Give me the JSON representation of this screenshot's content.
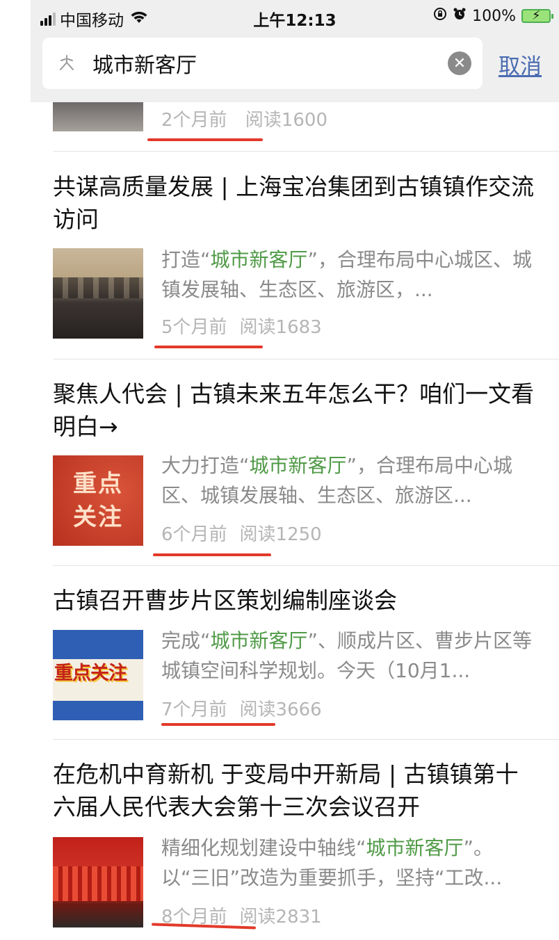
{
  "status_bar": {
    "carrier": "中国移动",
    "time": "上午12:13",
    "battery": "100%"
  },
  "search": {
    "query": "城市新客厅",
    "cancel_label": "取消"
  },
  "first_item": {
    "time": "2个月前",
    "reads": "阅读1600"
  },
  "results": [
    {
      "title": "共谋高质量发展 | 上海宝冶集团到古镇镇作交流访问",
      "snippet_pre": "打造“",
      "snippet_hl": "城市新客厅",
      "snippet_post": "”，合理布局中心城区、城镇发展轴、生态区、旅游区，...",
      "time": "5个月前",
      "reads": "阅读1683"
    },
    {
      "title": "聚焦人代会 | 古镇未来五年怎么干？咱们一文看明白→",
      "snippet_pre": "大力打造“",
      "snippet_hl": "城市新客厅",
      "snippet_post": "”，合理布局中心城区、城镇发展轴、生态区、旅游区...",
      "thumb_text_1": "重点",
      "thumb_text_2": "关注",
      "time": "6个月前",
      "reads": "阅读1250"
    },
    {
      "title": "古镇召开曹步片区策划编制座谈会",
      "snippet_pre": "完成“",
      "snippet_hl": "城市新客厅",
      "snippet_post": "”、顺成片区、曹步片区等城镇空间科学规划。今天（10月1...",
      "thumb_text": "重点关注",
      "time": "7个月前",
      "reads": "阅读3666"
    },
    {
      "title": "在危机中育新机 于变局中开新局 | 古镇镇第十六届人民代表大会第十三次会议召开",
      "snippet_pre": "精细化规划建设中轴线“",
      "snippet_hl": "城市新客厅",
      "snippet_post": "”。以“三旧”改造为重要抓手，坚持“工改...",
      "time": "8个月前",
      "reads": "阅读2831"
    }
  ],
  "colors": {
    "highlight": "#4f9a46",
    "annotation": "#e23a2a",
    "link": "#4a6cb0"
  }
}
